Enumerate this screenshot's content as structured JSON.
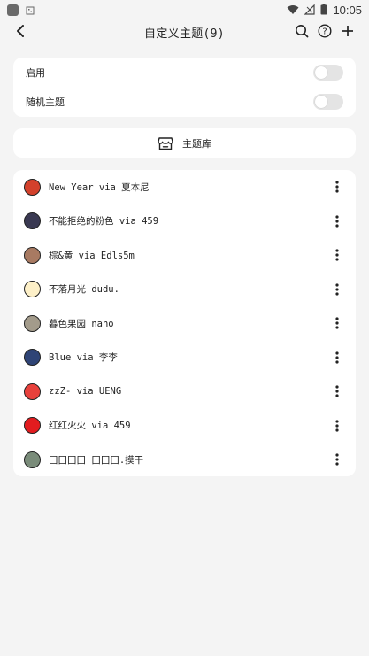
{
  "status_bar": {
    "time": "10:05",
    "icons": [
      "app-icon",
      "notification-icon",
      "wifi-icon",
      "signal-icon",
      "battery-icon"
    ]
  },
  "header": {
    "title": "自定义主题(9)",
    "icons": [
      "back-arrow-icon",
      "search-icon",
      "help-icon",
      "add-icon"
    ]
  },
  "settings": {
    "enable_label": "启用",
    "enable_on": false,
    "random_label": "随机主题",
    "random_on": false
  },
  "library": {
    "label": "主题库",
    "icon": "store-icon"
  },
  "themes": [
    {
      "name": "New Year via 夏本尼",
      "color": "#d3412c"
    },
    {
      "name": "不能拒绝的粉色 via 459",
      "color": "#3a3952"
    },
    {
      "name": "棕&黄 via Edls5m",
      "color": "#a87a62"
    },
    {
      "name": "不落月光 dudu.",
      "color": "#fdf0c8"
    },
    {
      "name": "暮色果园 nano",
      "color": "#a39b8b"
    },
    {
      "name": "Blue via 李李",
      "color": "#2f4476"
    },
    {
      "name": "zzZ- via UENG",
      "color": "#e8413c"
    },
    {
      "name": "红红火火 via 459",
      "color": "#e21c1f"
    },
    {
      "name": "囗囗囗囗 囗囗囗.摸干",
      "color": "#7a8c7a"
    }
  ]
}
